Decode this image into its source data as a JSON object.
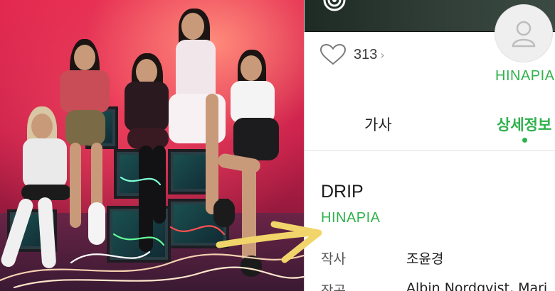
{
  "photo": {
    "description_icon": "photo-group",
    "accent": "#e3284f"
  },
  "app": {
    "like_count": "313",
    "like_chevron": "›",
    "artist_top": "HINAPIA",
    "tabs": [
      {
        "label": "가사"
      },
      {
        "label": "상세정보"
      }
    ],
    "song": {
      "title": "DRIP",
      "artist": "HINAPIA"
    },
    "credits": [
      {
        "label": "작사",
        "value": "조윤경"
      },
      {
        "label": "작곡",
        "value": "Albin Nordqvist, Mari"
      }
    ],
    "accent_color": "#2fb24c"
  },
  "annotation": {
    "arrow_color": "#f2d56a"
  }
}
